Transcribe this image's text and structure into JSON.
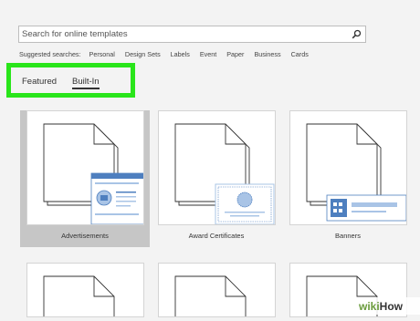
{
  "search": {
    "placeholder": "Search for online templates"
  },
  "suggested": {
    "label": "Suggested searches:",
    "items": [
      "Personal",
      "Design Sets",
      "Labels",
      "Event",
      "Paper",
      "Business",
      "Cards"
    ]
  },
  "tabs": [
    {
      "label": "Featured",
      "active": false
    },
    {
      "label": "Built-In",
      "active": true
    }
  ],
  "templates": [
    {
      "label": "Advertisements",
      "selected": true
    },
    {
      "label": "Award Certificates",
      "selected": false
    },
    {
      "label": "Banners",
      "selected": false
    },
    {
      "label": "",
      "selected": false
    },
    {
      "label": "",
      "selected": false
    },
    {
      "label": "",
      "selected": false
    }
  ],
  "watermark": {
    "wiki": "wiki",
    "how": "How"
  },
  "colors": {
    "highlight": "#29e51a",
    "accent_blue": "#4e7fbf",
    "light_blue": "#a9c4e6",
    "selected_bg": "#c6c6c6"
  }
}
